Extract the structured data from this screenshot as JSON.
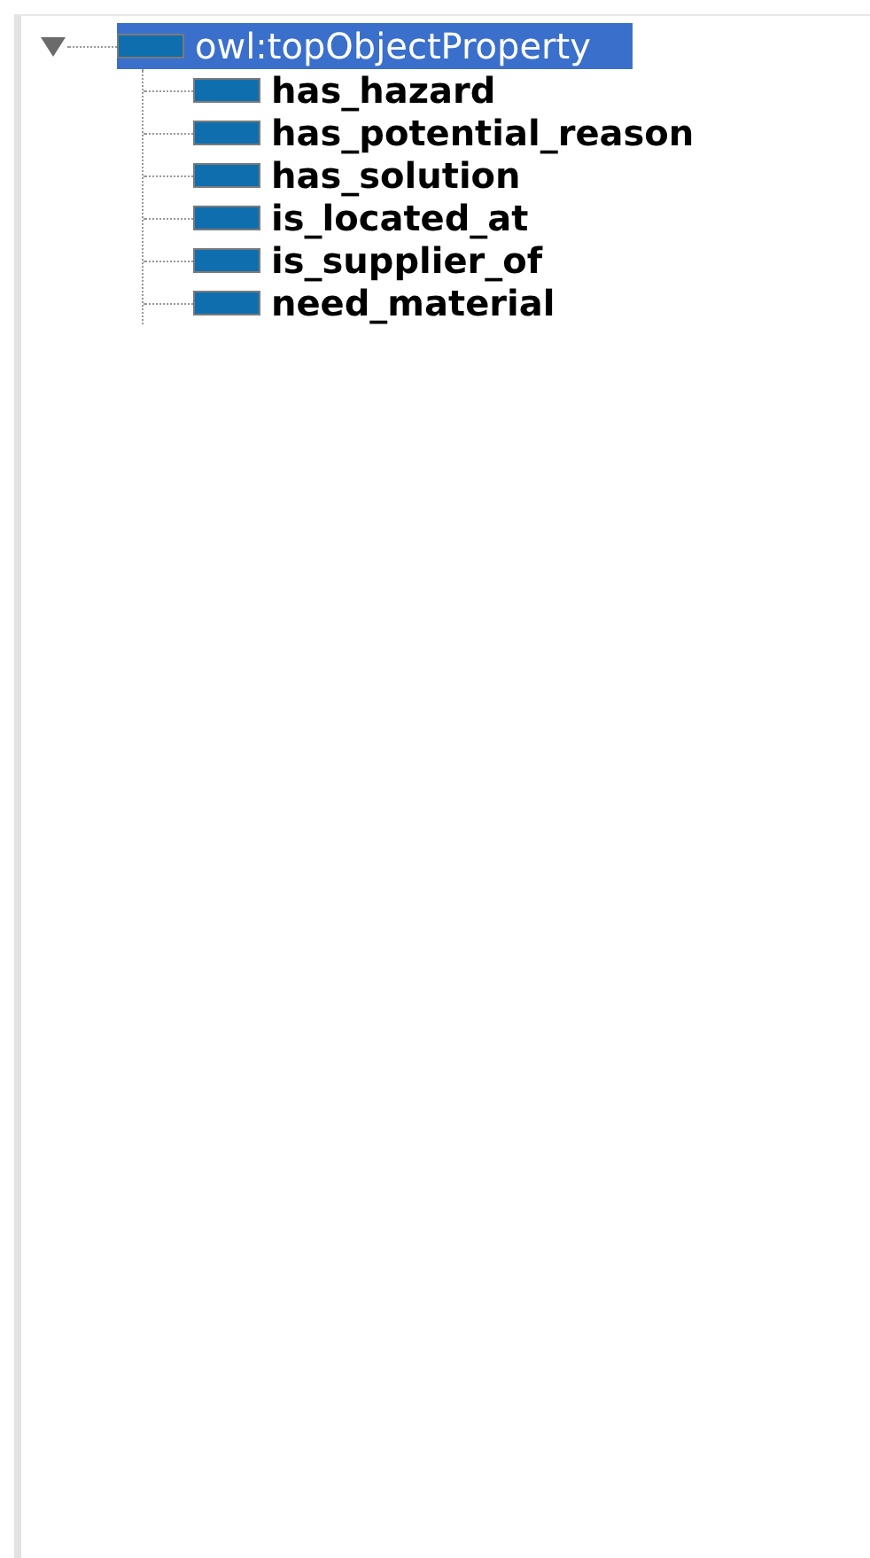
{
  "tree": {
    "label": "owl:topObjectProperty",
    "selected": true,
    "expanded": true,
    "children": [
      {
        "label": "has_hazard",
        "selected": false
      },
      {
        "label": "has_potential_reason",
        "selected": false
      },
      {
        "label": "has_solution",
        "selected": false
      },
      {
        "label": "is_located_at",
        "selected": false
      },
      {
        "label": "is_supplier_of",
        "selected": false
      },
      {
        "label": "need_material",
        "selected": false
      }
    ]
  }
}
